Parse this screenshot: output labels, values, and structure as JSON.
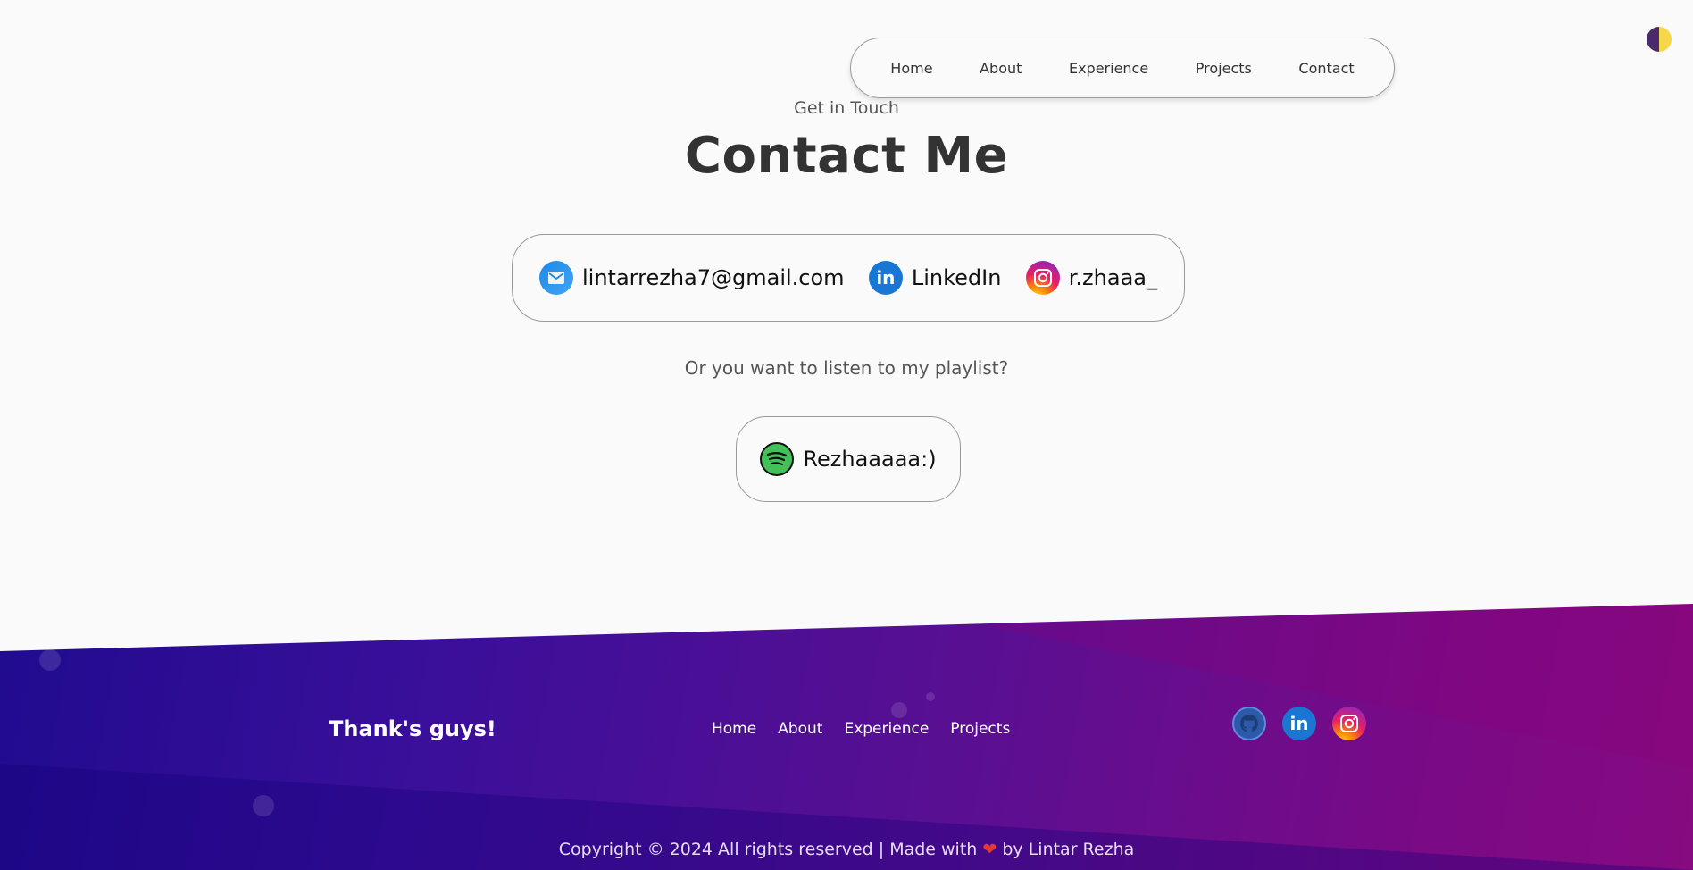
{
  "nav": {
    "items": [
      "Home",
      "About",
      "Experience",
      "Projects",
      "Contact"
    ]
  },
  "contact": {
    "subtitle": "Get in Touch",
    "title": "Contact Me",
    "email": "lintarrezha7@gmail.com",
    "linkedin": "LinkedIn",
    "instagram": "r.zhaaa_",
    "playlist_question": "Or you want to listen to my playlist?",
    "spotify": "Rezhaaaaa:)"
  },
  "footer": {
    "brand": "Thank's guys!",
    "nav": [
      "Home",
      "About",
      "Experience",
      "Projects"
    ],
    "copyright_prefix": "Copyright © 2024 All rights reserved | Made with",
    "copyright_suffix": "by Lintar Rezha",
    "heart": "❤"
  },
  "icons": {
    "linkedin_glyph": "in"
  },
  "colors": {
    "footer_start": "#1a0a8c",
    "footer_end": "#860a80",
    "spotify_green": "#43c05a",
    "linkedin_blue": "#1976d2"
  }
}
